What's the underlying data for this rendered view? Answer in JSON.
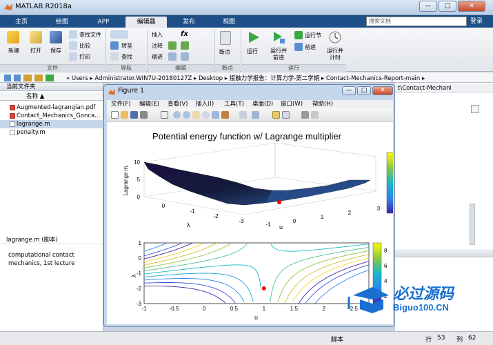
{
  "window": {
    "title": "MATLAB R2018a",
    "minimize": "—",
    "maximize": "□",
    "close": "✕"
  },
  "tabs": [
    {
      "label": "主页"
    },
    {
      "label": "绘图"
    },
    {
      "label": "APP"
    },
    {
      "label": "编辑器"
    },
    {
      "label": "发布"
    },
    {
      "label": "视图"
    }
  ],
  "search": {
    "placeholder": "搜索文档"
  },
  "login": "登录",
  "ribbon": {
    "file": {
      "new": "新建",
      "open": "打开",
      "save": "保存",
      "find_files": "查找文件",
      "compare": "比较",
      "print": "打印",
      "group": "文件"
    },
    "nav": {
      "goto": "转至",
      "find": "查找",
      "group": "导航"
    },
    "edit": {
      "insert": "插入",
      "comment": "注释",
      "indent": "缩进",
      "fx": "fx",
      "group": "编辑"
    },
    "breakpoints": {
      "label": "断点",
      "group": "断点"
    },
    "run": {
      "run": "运行",
      "run_advance": "运行并\n前进",
      "run_section": "运行节",
      "advance": "前进",
      "run_time": "运行并\n计时",
      "group": "运行"
    }
  },
  "path": {
    "segments": "« Users ▸ Administrator.WIN7U-20180127Z ▸ Desktop ▸ 接触力学报告：计算力学-第二学期 ▸ Contact-Mechanics-Report-main ▸"
  },
  "left_panel": {
    "title": "当前文件夹",
    "column": "名称 ▲",
    "files": [
      {
        "name": "Augmented-lagrangian.pdf"
      },
      {
        "name": "Contact_Mechanics_Gonca..."
      },
      {
        "name": "lagrange.m"
      },
      {
        "name": "penalty.m"
      }
    ]
  },
  "details": {
    "title": "lagrange.m  (脚本)",
    "text": "computational contact mechanics, 1st lecture"
  },
  "right_panel": {
    "path": "t\\Contact-Mechani"
  },
  "figure": {
    "title": "Figure 1",
    "menu": [
      "文件(F)",
      "编辑(E)",
      "查看(V)",
      "插入(I)",
      "工具(T)",
      "桌面(D)",
      "窗口(W)",
      "帮助(H)"
    ]
  },
  "status": {
    "mode": "脚本",
    "row_label": "行",
    "row": "53",
    "col_label": "列",
    "col": "62"
  },
  "chart_data": [
    {
      "type": "surface",
      "title": "Potential energy function w/ Lagrange multiplier",
      "xlabel": "u",
      "ylabel": "λ",
      "zlabel": "Lagrange m.",
      "xticks": [
        "-1",
        "0",
        "1",
        "2",
        "3"
      ],
      "yticks": [
        "-3",
        "-2",
        "-1",
        "0"
      ],
      "zticks": [
        "0",
        "5",
        "10"
      ],
      "xlim": [
        -1,
        3
      ],
      "ylim": [
        -3,
        0
      ],
      "zlim": [
        0,
        10
      ],
      "colorbar": "right",
      "marker": {
        "x": 1,
        "y": -2,
        "color": "#ff0000"
      }
    },
    {
      "type": "contour",
      "xlabel": "u",
      "ylabel": "λ",
      "xticks": [
        "-1",
        "-0.5",
        "0",
        "0.5",
        "1",
        "1.5",
        "2",
        "2.5"
      ],
      "yticks": [
        "-3",
        "-2",
        "-1",
        "0",
        "1"
      ],
      "xlim": [
        -1,
        2.75
      ],
      "ylim": [
        -3,
        1
      ],
      "colorbar_ticks": [
        "2",
        "4",
        "6",
        "8"
      ],
      "colorbar": "right",
      "marker": {
        "x": 1,
        "y": -2,
        "color": "#ff0000"
      }
    }
  ],
  "watermark": {
    "text": "必过源码",
    "url": "Biguo100.CN"
  }
}
